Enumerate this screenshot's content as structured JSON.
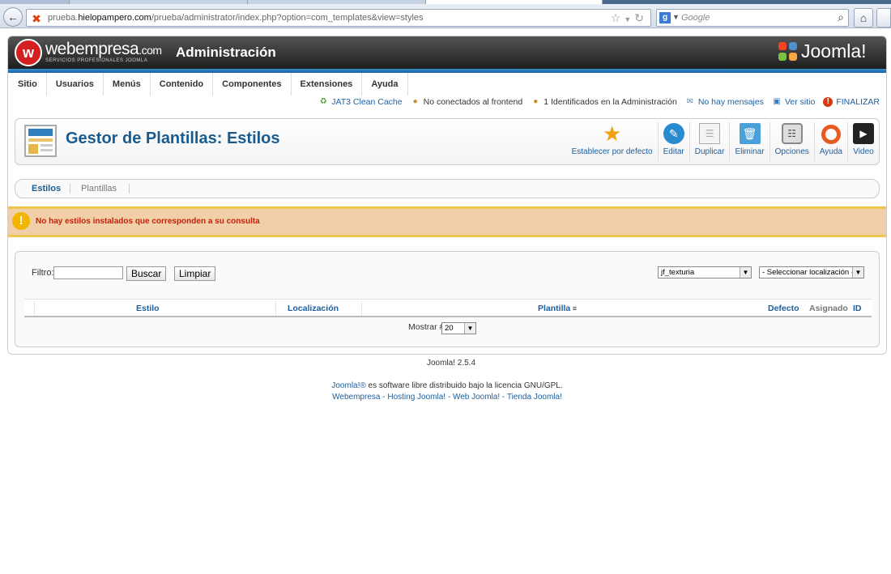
{
  "browser": {
    "url_prefix": "prueba.",
    "url_domain": "hielopampero.com",
    "url_path": "/prueba/administrator/index.php?option=com_templates&view=styles",
    "search_placeholder": "Google"
  },
  "header": {
    "brand_name": "webempresa",
    "brand_suffix": ".com",
    "brand_tagline": "SERVICIOS PROFESIONALES JOOMLA",
    "title": "Administración",
    "joomla_word": "Joomla!"
  },
  "menu": {
    "items": [
      "Sitio",
      "Usuarios",
      "Menús",
      "Contenido",
      "Componentes",
      "Extensiones",
      "Ayuda"
    ]
  },
  "status": {
    "cache": "JAT3 Clean Cache",
    "frontend": "No conectados al frontend",
    "admin": "1 Identificados en la Administración",
    "messages": "No hay mensajes",
    "view_site": "Ver sitio",
    "logout": "FINALIZAR"
  },
  "toolbar": {
    "page_title": "Gestor de Plantillas: Estilos",
    "default_label": "Establecer por defecto",
    "edit_label": "Editar",
    "duplicate_label": "Duplicar",
    "delete_label": "Eliminar",
    "options_label": "Opciones",
    "help_label": "Ayuda",
    "video_label": "Video"
  },
  "tabs": {
    "styles": "Estilos",
    "templates": "Plantillas"
  },
  "notice": {
    "message": "No hay estilos instalados que corresponden a su consulta"
  },
  "filter": {
    "label": "Filtro:",
    "value": "",
    "search_button": "Buscar",
    "clear_button": "Limpiar",
    "template_select": "jf_texturia",
    "location_select": "- Seleccionar localización -"
  },
  "table": {
    "columns": {
      "style": "Estilo",
      "location": "Localización",
      "template": "Plantilla",
      "default": "Defecto",
      "assigned": "Asignado",
      "id": "ID"
    },
    "show_label": "Mostrar #",
    "show_value": "20"
  },
  "footer": {
    "version": "Joomla! 2.5.4",
    "license_link": "Joomla!®",
    "license_text": " es software libre distribuido bajo la licencia GNU/GPL.",
    "link1": "Webempresa",
    "link2": "Hosting Joomla!",
    "link3": "Web Joomla!",
    "link4": "Tienda Joomla!",
    "sep": " - "
  },
  "colors": {
    "title_blue": "#1a5b8e",
    "link_blue": "#1e5e9e",
    "notice_bg": "#f1cfa8",
    "notice_text": "#c4200a"
  }
}
